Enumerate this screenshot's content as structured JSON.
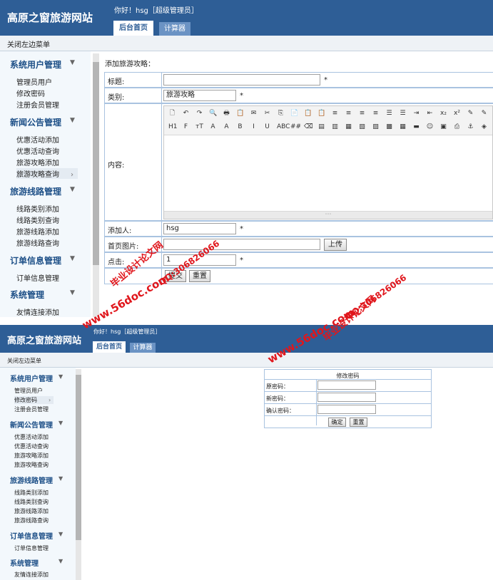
{
  "app": {
    "logo": "高原之窗旅游网站",
    "greeting": "你好！hsg［超级管理员］",
    "tabs": [
      "后台首页",
      "计算器"
    ],
    "close_menu": "关闭左边菜单"
  },
  "sidebar": {
    "groups": [
      {
        "title": "系统用户管理",
        "items": [
          "管理员用户",
          "修改密码",
          "注册会员管理"
        ]
      },
      {
        "title": "新闻公告管理",
        "items": [
          "优惠活动添加",
          "优惠活动查询",
          "旅游攻略添加",
          "旅游攻略查询"
        ]
      },
      {
        "title": "旅游线路管理",
        "items": [
          "线路类别添加",
          "线路类别查询",
          "旅游线路添加",
          "旅游线路查询"
        ]
      },
      {
        "title": "订单信息管理",
        "items": [
          "订单信息管理"
        ]
      },
      {
        "title": "系统管理",
        "items": [
          "友情连接添加"
        ]
      }
    ],
    "arrow_glyph": "▼",
    "expand_glyph": "›"
  },
  "strategy_form": {
    "heading": "添加旅游攻略：",
    "labels": {
      "title": "标题:",
      "category": "类别:",
      "content": "内容:",
      "author": "添加人:",
      "image": "首页图片:",
      "clicks": "点击:"
    },
    "category_value": "旅游攻略",
    "author_value": "hsg",
    "clicks_value": "1",
    "required_mark": "*",
    "upload_button": "上传",
    "submit_button": "提交",
    "reset_button": "重置",
    "editor_row1": [
      "🗋",
      "↶",
      "↷",
      "🔍",
      "🖶",
      "📋",
      "✉",
      "✂",
      "⎘",
      "📄",
      "📋",
      "📋",
      "≡",
      "≡",
      "≡",
      "≡",
      "☰",
      "☰",
      "⇥",
      "⇤",
      "x₂",
      "x²",
      "✎",
      "✎"
    ],
    "editor_row2": [
      "H1",
      "F",
      "тT",
      "A",
      "A",
      "B",
      "I",
      "U",
      "ABC",
      "##",
      "⌫",
      "▤",
      "▥",
      "▦",
      "▧",
      "▨",
      "▩",
      "▦",
      "▬",
      "☺",
      "▣",
      "⎙",
      "⚓",
      "◈"
    ],
    "resize_glyph": "⋯"
  },
  "password_form": {
    "heading": "修改密码",
    "labels": [
      "原密码：",
      "新密码：",
      "确认密码："
    ],
    "confirm_button": "确定",
    "reset_button": "重置"
  },
  "watermarks": {
    "site": "www.56doc.com",
    "qq": "QQ:306826066",
    "name": "毕业设计论文网"
  },
  "colors": {
    "header": "#2e5e96",
    "group_title": "#1d4f87",
    "watermark": "#e0161c"
  }
}
